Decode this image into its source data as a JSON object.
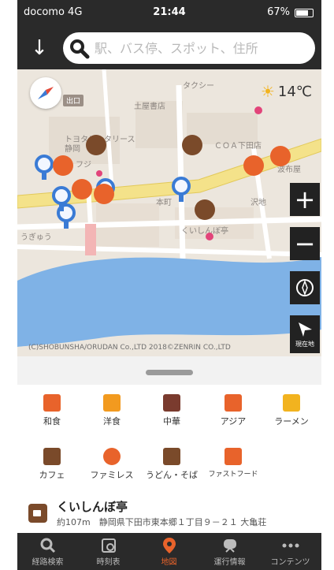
{
  "status": {
    "carrier": "docomo  4G",
    "time": "21:44",
    "battery": "67%"
  },
  "search": {
    "placeholder": "駅、バス停、スポット、住所"
  },
  "map": {
    "weather": "14℃",
    "exit_label": "出口",
    "labels": [
      "土屋書店",
      "タクシー",
      "トヨタレンタリース",
      "静岡",
      "フジ",
      "うぎゅう",
      "本町",
      "ＣＯＡ下田店",
      "波布屋",
      "沢地",
      "くいしんぼ亭"
    ],
    "copyright": "(C)SHOBUNSHA/ORUDAN Co.,LTD 2018©ZENRIN CO.,LTD",
    "current_location_label": "現在地"
  },
  "categories": [
    {
      "label": "和食",
      "color": "#e8632b"
    },
    {
      "label": "洋食",
      "color": "#f29a1f"
    },
    {
      "label": "中華",
      "color": "#7a3b2e"
    },
    {
      "label": "アジア",
      "color": "#e8632b"
    },
    {
      "label": "ラーメン",
      "color": "#f2b31f"
    },
    {
      "label": "カフェ",
      "color": "#7a4a2a"
    },
    {
      "label": "ファミレス",
      "color": "#e8632b"
    },
    {
      "label": "うどん・そば",
      "color": "#7a4a2a"
    },
    {
      "label": "ファストフード",
      "color": "#e8632b"
    }
  ],
  "spot": {
    "name": "くいしんぼ亭",
    "address": "約107m　静岡県下田市東本郷１丁目９－２１ 大亀荘"
  },
  "tabs": [
    {
      "label": "経路検索"
    },
    {
      "label": "時刻表"
    },
    {
      "label": "地図"
    },
    {
      "label": "運行情報"
    },
    {
      "label": "コンテンツ"
    }
  ],
  "colors": {
    "accent": "#e8632b",
    "bar": "#2a2a2a"
  }
}
